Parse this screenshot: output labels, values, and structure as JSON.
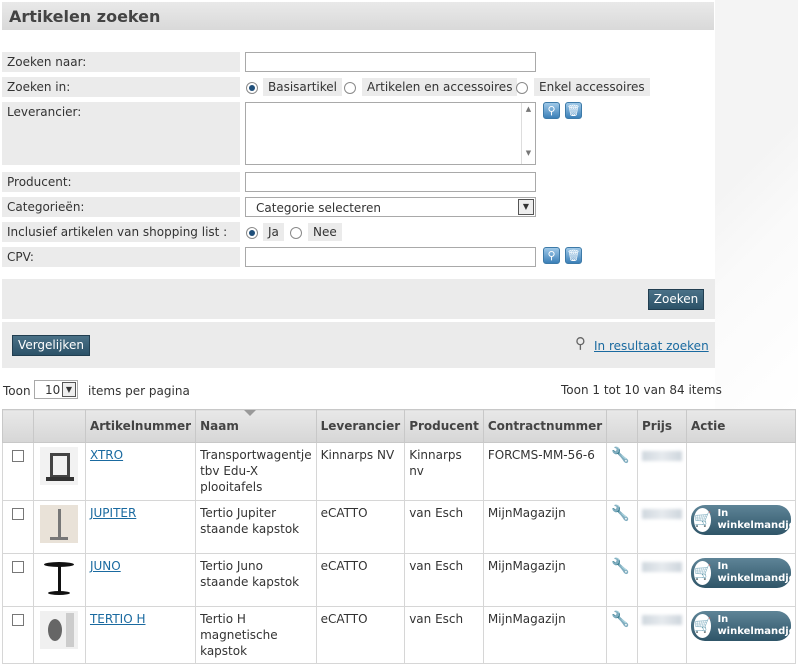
{
  "title": "Artikelen zoeken",
  "form": {
    "zoeken_naar_label": "Zoeken naar:",
    "zoeken_naar_value": "",
    "zoeken_in_label": "Zoeken in:",
    "zoeken_in_options": [
      "Basisartikel",
      "Artikelen en accessoires",
      "Enkel accessoires"
    ],
    "zoeken_in_selected": "Basisartikel",
    "leverancier_label": "Leverancier:",
    "producent_label": "Producent:",
    "categorieen_label": "Categorieën:",
    "categorie_selected": "Categorie selecteren",
    "shopping_label": "Inclusief artikelen van shopping list :",
    "shopping_options": [
      "Ja",
      "Nee"
    ],
    "shopping_selected": "Ja",
    "cpv_label": "CPV:"
  },
  "buttons": {
    "zoeken": "Zoeken",
    "vergelijken": "Vergelijken",
    "in_resultaat": "In resultaat zoeken"
  },
  "paging": {
    "toon": "Toon",
    "per_page": "10",
    "items_per_pagina": "items per pagina",
    "summary": "Toon 1 tot 10 van 84 items"
  },
  "table": {
    "headers": [
      "Artikelnummer",
      "Naam",
      "Leverancier",
      "Producent",
      "Contractnummer",
      "Prijs",
      "Actie"
    ],
    "rows": [
      {
        "artikelnummer": "XTRO",
        "naam": "Transportwagentje tbv Edu-X plooitafels",
        "leverancier": "Kinnarps NV",
        "producent": "Kinnarps nv",
        "contract": "FORCMS-MM-56-6",
        "cart": false
      },
      {
        "artikelnummer": "JUPITER",
        "naam": "Tertio Jupiter staande kapstok",
        "leverancier": "eCATTO",
        "producent": "van Esch",
        "contract": "MijnMagazijn",
        "cart": true
      },
      {
        "artikelnummer": "JUNO",
        "naam": "Tertio Juno staande kapstok",
        "leverancier": "eCATTO",
        "producent": "van Esch",
        "contract": "MijnMagazijn",
        "cart": true
      },
      {
        "artikelnummer": "TERTIO H",
        "naam": "Tertio H magnetische kapstok",
        "leverancier": "eCATTO",
        "producent": "van Esch",
        "contract": "MijnMagazijn",
        "cart": true
      }
    ],
    "cart_label_1": "In",
    "cart_label_2": "winkelmandje"
  }
}
